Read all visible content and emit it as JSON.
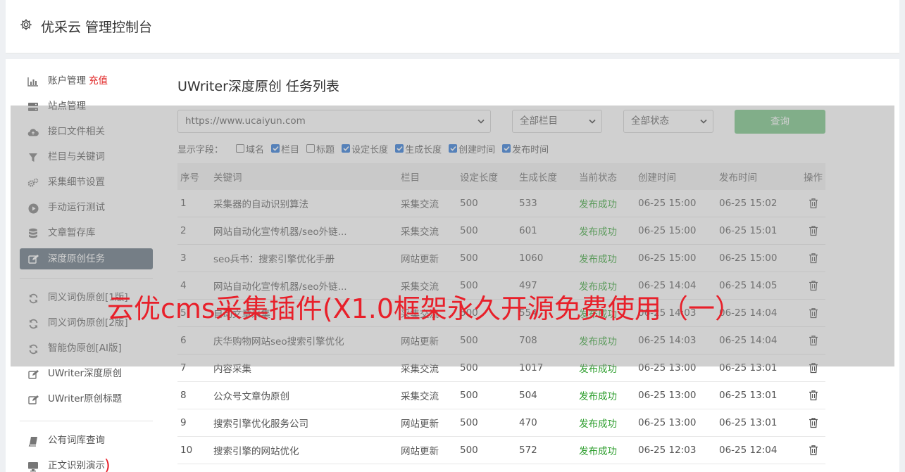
{
  "header": {
    "title": "优采云 管理控制台",
    "icon": "gear-icon"
  },
  "sidebar": {
    "items": [
      {
        "label": "账户管理",
        "badge": "充值",
        "icon": "bar-chart-icon"
      },
      {
        "label": "站点管理",
        "icon": "server-icon"
      },
      {
        "label": "接口文件相关",
        "icon": "cloud-upload-icon"
      },
      {
        "label": "栏目与关键词",
        "icon": "filter-icon"
      },
      {
        "label": "采集细节设置",
        "icon": "gears-icon"
      },
      {
        "label": "手动运行测试",
        "icon": "play-icon"
      },
      {
        "label": "文章暂存库",
        "icon": "database-icon"
      },
      {
        "label": "深度原创任务",
        "icon": "edit-icon",
        "active": true
      }
    ],
    "items2": [
      {
        "label": "同义词伪原创[1版]",
        "icon": "refresh-icon"
      },
      {
        "label": "同义词伪原创[2版]",
        "icon": "refresh-icon"
      },
      {
        "label": "智能伪原创[AI版]",
        "icon": "refresh-icon"
      },
      {
        "label": "UWriter深度原创",
        "icon": "edit-icon"
      },
      {
        "label": "UWriter原创标题",
        "icon": "edit-icon"
      }
    ],
    "items3": [
      {
        "label": "公有词库查询",
        "icon": "book-icon"
      },
      {
        "label": "正文识别演示",
        "icon": "monitor-icon"
      }
    ]
  },
  "main": {
    "title": "UWriter深度原创 任务列表",
    "filters": {
      "site": "https://www.ucaiyun.com",
      "column": "全部栏目",
      "status": "全部状态",
      "query_label": "查询"
    },
    "fields": {
      "label": "显示字段：",
      "items": [
        {
          "label": "域名",
          "checked": false
        },
        {
          "label": "栏目",
          "checked": true
        },
        {
          "label": "标题",
          "checked": false
        },
        {
          "label": "设定长度",
          "checked": true
        },
        {
          "label": "生成长度",
          "checked": true
        },
        {
          "label": "创建时间",
          "checked": true
        },
        {
          "label": "发布时间",
          "checked": true
        }
      ]
    },
    "table": {
      "headers": [
        "序号",
        "关键词",
        "栏目",
        "设定长度",
        "生成长度",
        "当前状态",
        "创建时间",
        "发布时间",
        "操作"
      ],
      "rows": [
        [
          "1",
          "采集器的自动识别算法",
          "采集交流",
          "500",
          "533",
          "发布成功",
          "06-25 15:00",
          "06-25 15:02"
        ],
        [
          "2",
          "网站自动化宣传机器/seo外链...",
          "采集交流",
          "500",
          "601",
          "发布成功",
          "06-25 15:00",
          "06-25 15:01"
        ],
        [
          "3",
          "seo兵书：搜索引擎优化手册",
          "网站更新",
          "500",
          "1060",
          "发布成功",
          "06-25 15:00",
          "06-25 15:00"
        ],
        [
          "4",
          "网站自动化宣传机器/seo外链...",
          "采集交流",
          "500",
          "497",
          "发布成功",
          "06-25 14:04",
          "06-25 14:05"
        ],
        [
          "5",
          "自动文章采集",
          "采集交流",
          "500",
          "554",
          "发布成功",
          "06-25 14:03",
          "06-25 14:04"
        ],
        [
          "6",
          "庆华购物网站seo搜索引擎优化",
          "网站更新",
          "500",
          "708",
          "发布成功",
          "06-25 14:03",
          "06-25 14:04"
        ],
        [
          "7",
          "内容采集",
          "采集交流",
          "500",
          "1017",
          "发布成功",
          "06-25 13:00",
          "06-25 13:01"
        ],
        [
          "8",
          "公众号文章伪原创",
          "采集交流",
          "500",
          "504",
          "发布成功",
          "06-25 13:00",
          "06-25 13:01"
        ],
        [
          "9",
          "搜索引擎优化服务公司",
          "网站更新",
          "500",
          "470",
          "发布成功",
          "06-25 13:00",
          "06-25 13:01"
        ],
        [
          "10",
          "搜索引擎的网站优化",
          "网站更新",
          "500",
          "572",
          "发布成功",
          "06-25 12:03",
          "06-25 12:04"
        ]
      ]
    }
  },
  "watermark": {
    "text": "云优cms采集插件(X1.0框架永久开源免费使用（一）",
    "paren": ")"
  },
  "colors": {
    "accent": "#6fc17e",
    "active_nav": "#5a6b78",
    "success": "#2e9e2e",
    "watermark": "#e8202a"
  }
}
